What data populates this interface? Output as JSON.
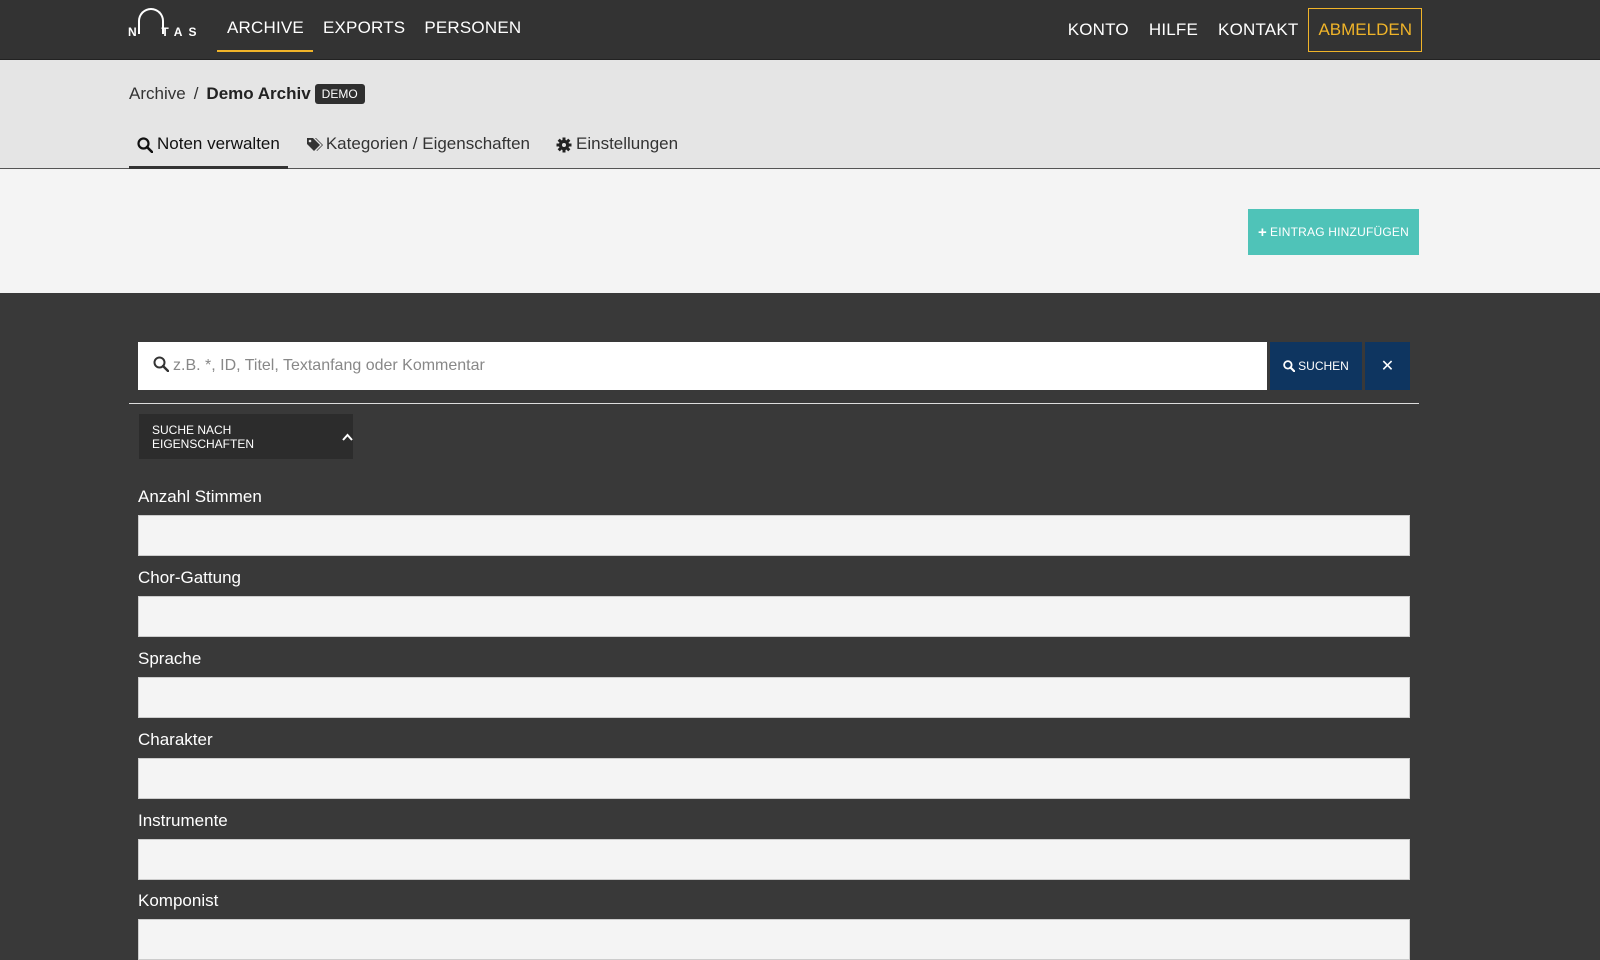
{
  "brand": {
    "logo_letters": "N  TAS"
  },
  "nav": {
    "left": [
      "ARCHIVE",
      "EXPORTS",
      "PERSONEN"
    ],
    "right": [
      "KONTO",
      "HILFE",
      "KONTAKT"
    ],
    "logout": "ABMELDEN"
  },
  "breadcrumb": {
    "root": "Archive",
    "separator": "/",
    "current": "Demo Archiv",
    "badge": "DEMO"
  },
  "tabs": [
    {
      "label": "Noten verwalten",
      "icon": "search-icon"
    },
    {
      "label": "Kategorien / Eigenschaften",
      "icon": "tags-icon"
    },
    {
      "label": "Einstellungen",
      "icon": "gear-icon"
    }
  ],
  "actions": {
    "add_label": "EINTRAG HINZUFÜGEN",
    "add_icon": "plus-icon"
  },
  "search": {
    "placeholder": "z.B. *, ID, Titel, Textanfang oder Kommentar",
    "value": "",
    "button_label": "SUCHEN",
    "clear_label": "✕"
  },
  "properties": {
    "toggle_label": "SUCHE NACH EIGENSCHAFTEN",
    "fields": [
      "Anzahl Stimmen",
      "Chor-Gattung",
      "Sprache",
      "Charakter",
      "Instrumente",
      "Komponist"
    ]
  },
  "colors": {
    "topbar": "#333333",
    "accent_yellow": "#f0b429",
    "teal": "#4fc3b8",
    "navy": "#0e3560",
    "main_bg": "#393939"
  }
}
